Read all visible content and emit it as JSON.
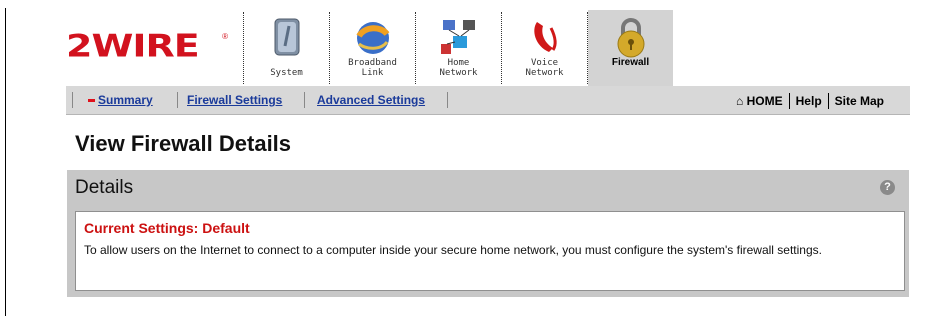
{
  "brand": {
    "logo_text": "2WIRE",
    "reg_mark": "®",
    "logo_color": "#d2121e"
  },
  "nav": {
    "items": [
      {
        "label": "System",
        "icon": "system-icon",
        "active": false
      },
      {
        "label": "Broadband\nLink",
        "icon": "broadband-link-icon",
        "active": false
      },
      {
        "label": "Home\nNetwork",
        "icon": "home-network-icon",
        "active": false
      },
      {
        "label": "Voice\nNetwork",
        "icon": "voice-network-icon",
        "active": false
      },
      {
        "label": "Firewall",
        "icon": "firewall-lock-icon",
        "active": true
      }
    ]
  },
  "subnav": {
    "tabs": [
      {
        "label": "Summary",
        "active": true
      },
      {
        "label": "Firewall Settings"
      },
      {
        "label": "Advanced Settings"
      }
    ],
    "right": {
      "home": "HOME",
      "help": "Help",
      "sitemap": "Site Map"
    }
  },
  "page": {
    "title": "View Firewall Details",
    "panel_title": "Details",
    "help_glyph": "?",
    "settings_heading": "Current Settings: Default",
    "description": "To allow users on the Internet to connect to a computer inside your secure home network, you must configure the system's firewall settings."
  },
  "colors": {
    "accent_red": "#cc1111",
    "link_blue": "#1a3a9a",
    "bar_gray": "#d8d8d8",
    "panel_gray": "#c7c7c7"
  }
}
